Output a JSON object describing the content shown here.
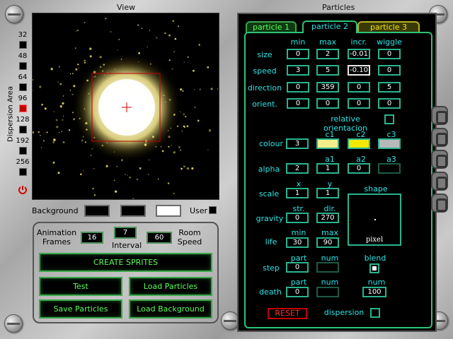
{
  "view": {
    "title": "View"
  },
  "dispersion": {
    "label": "Dispersion Area",
    "options": [
      "32",
      "48",
      "64",
      "96",
      "128",
      "192",
      "256"
    ],
    "selected": "96",
    "power_icon": "power-icon"
  },
  "background_row": {
    "label": "Background",
    "user_label": "User"
  },
  "animation": {
    "frames_label_1": "Animation",
    "frames_label_2": "Frames",
    "frames_value": "16",
    "interval_value": "7",
    "interval_label": "Interval",
    "room_speed_value": "60",
    "room_speed_label_1": "Room",
    "room_speed_label_2": "Speed"
  },
  "buttons": {
    "create_sprites": "CREATE SPRITES",
    "test": "Test",
    "load_particles": "Load Particles",
    "save_particles": "Save Particles",
    "load_background": "Load Background"
  },
  "particles": {
    "title": "Particles",
    "tabs": [
      "particle 1",
      "particle 2",
      "particle 3"
    ],
    "active_tab": "particle 2",
    "col_headers": [
      "min",
      "max",
      "incr.",
      "wiggle"
    ],
    "rows": [
      {
        "label": "size",
        "values": [
          "0",
          "2",
          "-0.01",
          "0"
        ]
      },
      {
        "label": "speed",
        "values": [
          "3",
          "5",
          "-0.10",
          "0"
        ]
      },
      {
        "label": "direction",
        "values": [
          "0",
          "359",
          "0",
          "5"
        ]
      },
      {
        "label": "orient.",
        "values": [
          "0",
          "0",
          "0",
          "0"
        ]
      }
    ],
    "relative_orientation": "relative orientacion",
    "colour": {
      "label": "colour",
      "value": "3",
      "headers": [
        "c1",
        "c2",
        "c3"
      ],
      "colors": [
        "#f3ee8c",
        "#f2e800",
        "#b9b9b9"
      ]
    },
    "alpha": {
      "label": "alpha",
      "headers": [
        "a1",
        "a2",
        "a3"
      ],
      "values": [
        "2",
        "1",
        "0",
        ""
      ]
    },
    "scale": {
      "label": "scale",
      "headers": [
        "x",
        "y"
      ],
      "values": [
        "1",
        "1"
      ]
    },
    "gravity": {
      "label": "gravity",
      "headers": [
        "str.",
        "dir."
      ],
      "values": [
        "0",
        "270"
      ]
    },
    "life": {
      "label": "life",
      "headers": [
        "min",
        "max"
      ],
      "values": [
        "30",
        "90"
      ]
    },
    "shape": {
      "label": "shape",
      "value": "pixel"
    },
    "step": {
      "label": "step",
      "headers": [
        "part",
        "num"
      ],
      "values": [
        "0",
        ""
      ]
    },
    "blend": {
      "label": "blend"
    },
    "death": {
      "label": "death",
      "headers": [
        "part",
        "num",
        "num"
      ],
      "values": [
        "0",
        "",
        "100"
      ]
    },
    "reset": "RESET",
    "dispersion": "dispersion",
    "accent": "#2fe3e3"
  }
}
